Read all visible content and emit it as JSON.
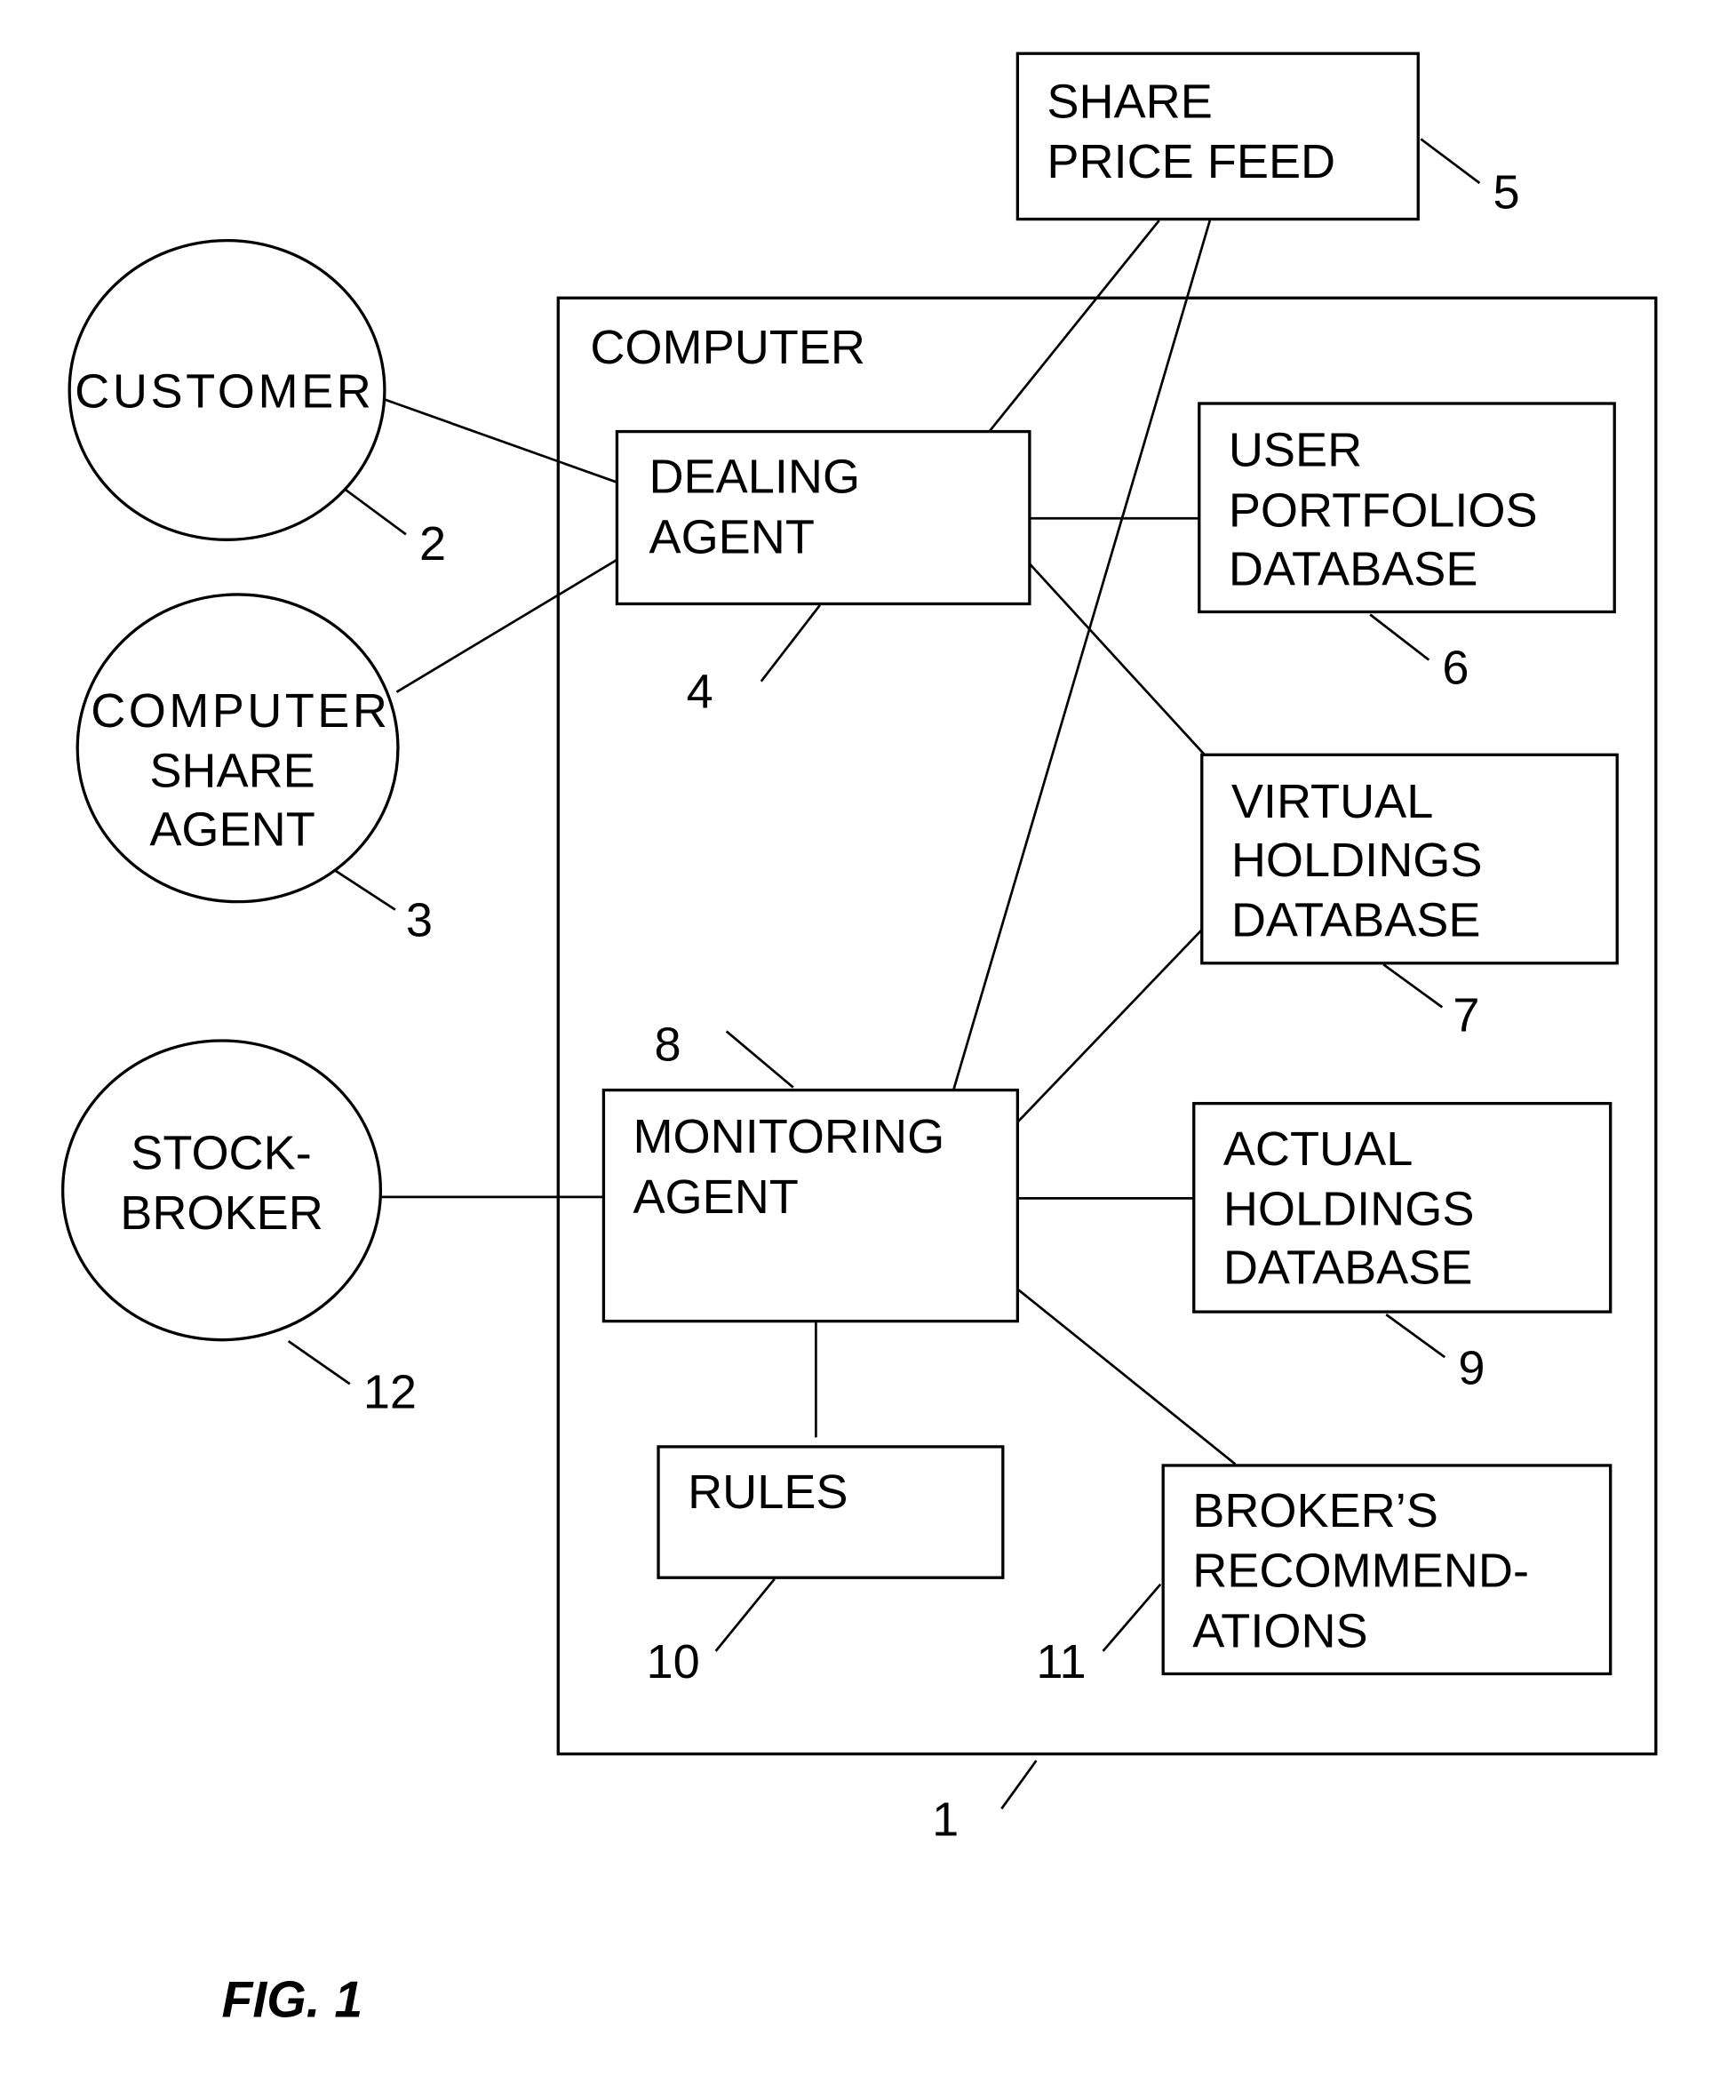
{
  "figure_label": "FIG. 1",
  "nodes": {
    "share_price_feed": {
      "lines": [
        "SHARE",
        "PRICE FEED"
      ],
      "ref": "5"
    },
    "computer": {
      "lines": [
        "COMPUTER"
      ],
      "ref": "1"
    },
    "customer": {
      "lines": [
        "CUSTOMER"
      ],
      "ref": "2"
    },
    "computer_share_agent": {
      "lines": [
        "COMPUTER",
        "SHARE",
        "AGENT"
      ],
      "ref": "3"
    },
    "dealing_agent": {
      "lines": [
        "DEALING",
        "AGENT"
      ],
      "ref": "4"
    },
    "user_portfolios_db": {
      "lines": [
        "USER",
        "PORTFOLIOS",
        "DATABASE"
      ],
      "ref": "6"
    },
    "virtual_holdings_db": {
      "lines": [
        "VIRTUAL",
        "HOLDINGS",
        "DATABASE"
      ],
      "ref": "7"
    },
    "monitoring_agent": {
      "lines": [
        "MONITORING",
        "AGENT"
      ],
      "ref": "8"
    },
    "actual_holdings_db": {
      "lines": [
        "ACTUAL",
        "HOLDINGS",
        "DATABASE"
      ],
      "ref": "9"
    },
    "rules": {
      "lines": [
        "RULES"
      ],
      "ref": "10"
    },
    "brokers_recommendations": {
      "lines": [
        "BROKER’S",
        "RECOMMEND-",
        "ATIONS"
      ],
      "ref": "11"
    },
    "stockbroker": {
      "lines": [
        "STOCK-",
        "BROKER"
      ],
      "ref": "12"
    }
  },
  "connections": [
    [
      "share_price_feed",
      "dealing_agent"
    ],
    [
      "share_price_feed",
      "monitoring_agent"
    ],
    [
      "customer",
      "dealing_agent"
    ],
    [
      "computer_share_agent",
      "dealing_agent"
    ],
    [
      "dealing_agent",
      "user_portfolios_db"
    ],
    [
      "dealing_agent",
      "virtual_holdings_db"
    ],
    [
      "monitoring_agent",
      "virtual_holdings_db"
    ],
    [
      "monitoring_agent",
      "actual_holdings_db"
    ],
    [
      "monitoring_agent",
      "rules"
    ],
    [
      "monitoring_agent",
      "brokers_recommendations"
    ],
    [
      "stockbroker",
      "monitoring_agent"
    ]
  ]
}
